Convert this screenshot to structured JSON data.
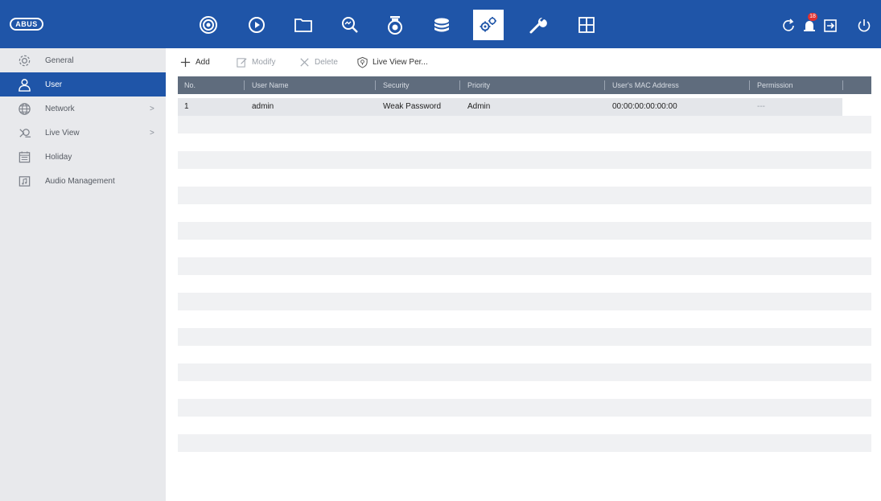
{
  "app": {
    "logo_text": "ABUS",
    "badge_count": "18"
  },
  "topnav": [
    {
      "name": "live-view",
      "icon": "camera-lens-icon"
    },
    {
      "name": "playback",
      "icon": "play-circle-icon"
    },
    {
      "name": "file-management",
      "icon": "folder-icon"
    },
    {
      "name": "smart-analysis",
      "icon": "magnifier-chart-icon"
    },
    {
      "name": "camera",
      "icon": "dome-camera-icon"
    },
    {
      "name": "storage",
      "icon": "database-icon"
    },
    {
      "name": "configuration",
      "icon": "gears-icon"
    },
    {
      "name": "maintenance",
      "icon": "wrench-icon"
    },
    {
      "name": "layout",
      "icon": "grid-icon"
    }
  ],
  "system_icons": [
    "refresh-icon",
    "alarm-icon",
    "logout-icon",
    "power-icon"
  ],
  "sidebar": {
    "items": [
      {
        "label": "General",
        "icon": "gear-icon",
        "arrow": ""
      },
      {
        "label": "User",
        "icon": "user-icon",
        "arrow": ""
      },
      {
        "label": "Network",
        "icon": "globe-icon",
        "arrow": ">"
      },
      {
        "label": "Live View",
        "icon": "live-view-icon",
        "arrow": ">"
      },
      {
        "label": "Holiday",
        "icon": "calendar-icon",
        "arrow": ""
      },
      {
        "label": "Audio Management",
        "icon": "audio-file-icon",
        "arrow": ""
      }
    ],
    "active_index": 1
  },
  "toolbar": {
    "add_label": "Add",
    "modify_label": "Modify",
    "delete_label": "Delete",
    "liveview_perm_label": "Live View Per..."
  },
  "table": {
    "columns": [
      "No.",
      "User Name",
      "Security",
      "Priority",
      "User's MAC Address",
      "Permission"
    ],
    "rows": [
      {
        "no": "1",
        "user_name": "admin",
        "security": "Weak Password",
        "priority": "Admin",
        "mac": "00:00:00:00:00:00",
        "permission": "---"
      }
    ]
  },
  "colors": {
    "brand_blue": "#1f55a8",
    "table_header": "#5f6c7d",
    "sidebar_bg": "#e8e9ec"
  }
}
